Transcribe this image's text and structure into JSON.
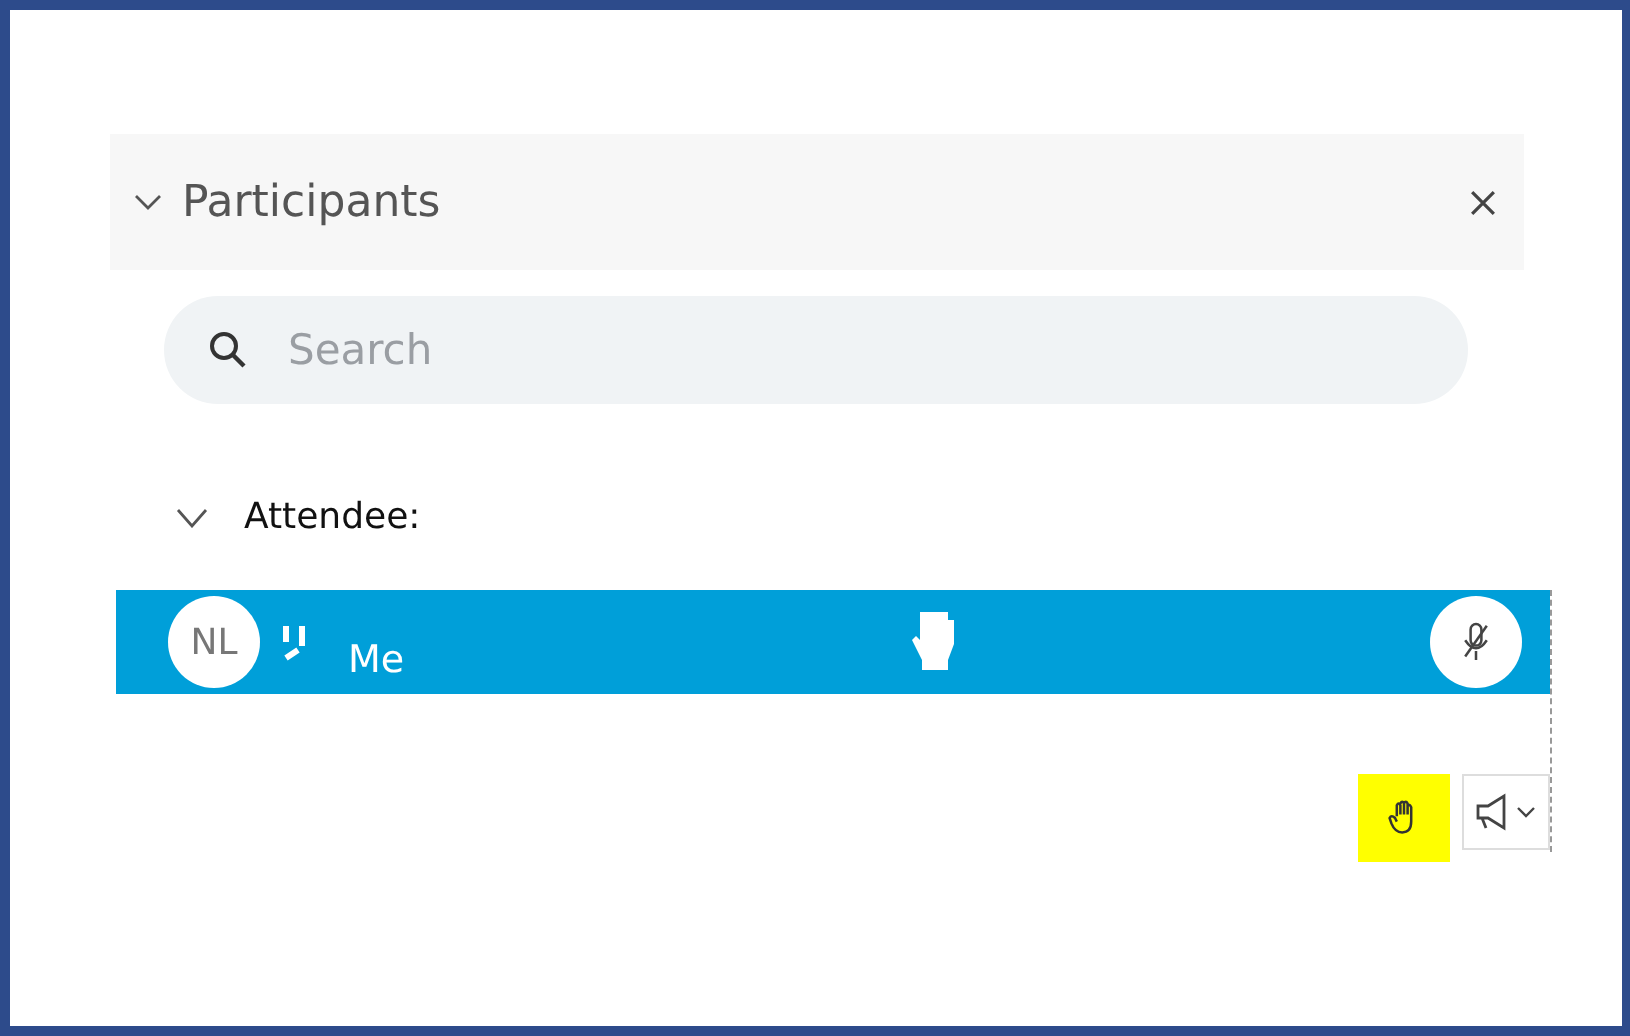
{
  "panel": {
    "title": "Participants",
    "expanded": true
  },
  "search": {
    "placeholder": "Search"
  },
  "group": {
    "title": "Attendee:",
    "expanded": true
  },
  "participant": {
    "initials": "NL",
    "subtitle": "Me",
    "selected": true,
    "hand_raised": true,
    "muted": true
  },
  "toolbar": {
    "raise_hand_highlighted": true
  }
}
